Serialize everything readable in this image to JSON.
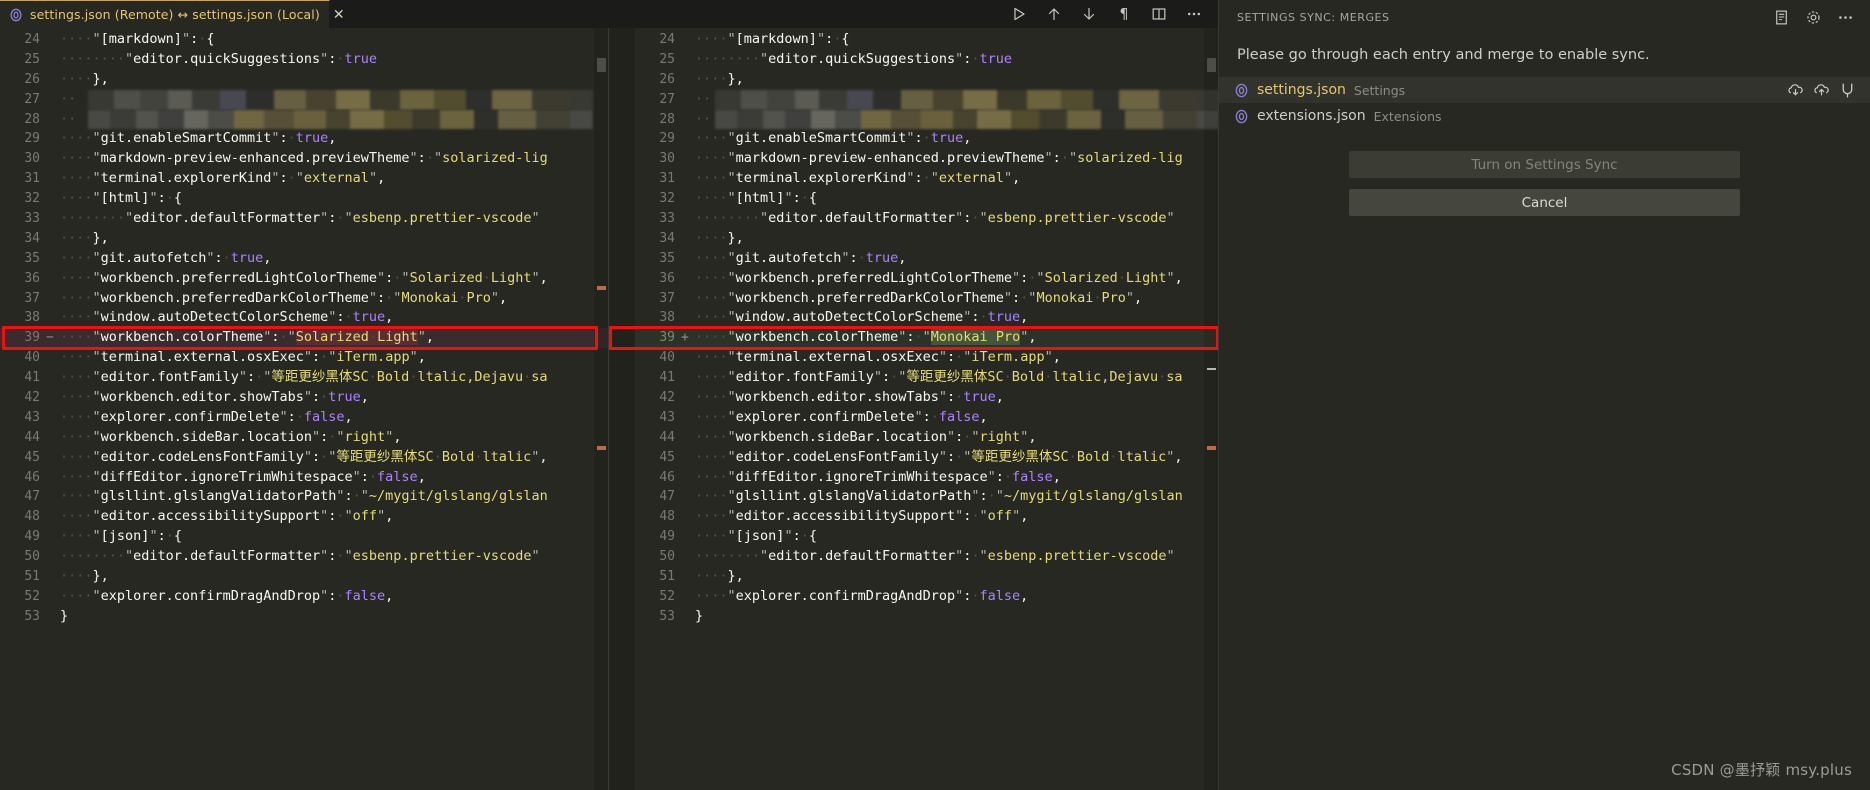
{
  "tab": {
    "icon": "json-file-icon",
    "label": "settings.json (Remote) ↔ settings.json (Local)",
    "close": "✕"
  },
  "toolbar": {
    "run_label": "▷",
    "prev_label": "↑",
    "next_label": "↓",
    "whitespace_label": "¶",
    "layout_label": "▥",
    "more_label": "⋯"
  },
  "diff": {
    "left_title": "settings.json (Remote)",
    "right_title": "settings.json (Local)",
    "left_lines": [
      {
        "n": "24",
        "sign": "",
        "state": "ctx",
        "indent": 4,
        "text": "\"[markdown]\": {"
      },
      {
        "n": "25",
        "sign": "",
        "state": "ctx",
        "indent": 8,
        "text": "\"editor.quickSuggestions\": true"
      },
      {
        "n": "26",
        "sign": "",
        "state": "ctx",
        "indent": 4,
        "text": "},"
      },
      {
        "n": "27",
        "sign": "",
        "state": "censored",
        "indent": 2,
        "text": ""
      },
      {
        "n": "28",
        "sign": "",
        "state": "censored",
        "indent": 2,
        "text": ""
      },
      {
        "n": "29",
        "sign": "",
        "state": "ctx",
        "indent": 4,
        "text": "\"git.enableSmartCommit\": true,"
      },
      {
        "n": "30",
        "sign": "",
        "state": "ctx",
        "indent": 4,
        "text": "\"markdown-preview-enhanced.previewTheme\": \"solarized-lig"
      },
      {
        "n": "31",
        "sign": "",
        "state": "ctx",
        "indent": 4,
        "text": "\"terminal.explorerKind\": \"external\","
      },
      {
        "n": "32",
        "sign": "",
        "state": "ctx",
        "indent": 4,
        "text": "\"[html]\": {"
      },
      {
        "n": "33",
        "sign": "",
        "state": "ctx",
        "indent": 8,
        "text": "\"editor.defaultFormatter\": \"esbenp.prettier-vscode\""
      },
      {
        "n": "34",
        "sign": "",
        "state": "ctx",
        "indent": 4,
        "text": "},"
      },
      {
        "n": "35",
        "sign": "",
        "state": "ctx",
        "indent": 4,
        "text": "\"git.autofetch\": true,"
      },
      {
        "n": "36",
        "sign": "",
        "state": "ctx",
        "indent": 4,
        "text": "\"workbench.preferredLightColorTheme\": \"Solarized Light\","
      },
      {
        "n": "37",
        "sign": "",
        "state": "ctx",
        "indent": 4,
        "text": "\"workbench.preferredDarkColorTheme\": \"Monokai Pro\","
      },
      {
        "n": "38",
        "sign": "",
        "state": "ctx",
        "indent": 4,
        "text": "\"window.autoDetectColorScheme\": true,"
      },
      {
        "n": "39",
        "sign": "−",
        "state": "deleted",
        "indent": 4,
        "text": "\"workbench.colorTheme\": \"Solarized Light\",",
        "highlight": "Solarized Light"
      },
      {
        "n": "40",
        "sign": "",
        "state": "ctx",
        "indent": 4,
        "text": "\"terminal.external.osxExec\": \"iTerm.app\","
      },
      {
        "n": "41",
        "sign": "",
        "state": "ctx",
        "indent": 4,
        "text": "\"editor.fontFamily\": \"等距更纱黑体SC Bold ltalic,Dejavu sa"
      },
      {
        "n": "42",
        "sign": "",
        "state": "ctx",
        "indent": 4,
        "text": "\"workbench.editor.showTabs\": true,"
      },
      {
        "n": "43",
        "sign": "",
        "state": "ctx",
        "indent": 4,
        "text": "\"explorer.confirmDelete\": false,"
      },
      {
        "n": "44",
        "sign": "",
        "state": "ctx",
        "indent": 4,
        "text": "\"workbench.sideBar.location\": \"right\","
      },
      {
        "n": "45",
        "sign": "",
        "state": "ctx",
        "indent": 4,
        "text": "\"editor.codeLensFontFamily\": \"等距更纱黑体SC Bold ltalic\","
      },
      {
        "n": "46",
        "sign": "",
        "state": "ctx",
        "indent": 4,
        "text": "\"diffEditor.ignoreTrimWhitespace\": false,"
      },
      {
        "n": "47",
        "sign": "",
        "state": "ctx",
        "indent": 4,
        "text": "\"glsllint.glslangValidatorPath\": \"~/mygit/glslang/glslan"
      },
      {
        "n": "48",
        "sign": "",
        "state": "ctx",
        "indent": 4,
        "text": "\"editor.accessibilitySupport\": \"off\","
      },
      {
        "n": "49",
        "sign": "",
        "state": "ctx",
        "indent": 4,
        "text": "\"[json]\": {"
      },
      {
        "n": "50",
        "sign": "",
        "state": "ctx",
        "indent": 8,
        "text": "\"editor.defaultFormatter\": \"esbenp.prettier-vscode\""
      },
      {
        "n": "51",
        "sign": "",
        "state": "ctx",
        "indent": 4,
        "text": "},"
      },
      {
        "n": "52",
        "sign": "",
        "state": "ctx",
        "indent": 4,
        "text": "\"explorer.confirmDragAndDrop\": false,"
      },
      {
        "n": "53",
        "sign": "",
        "state": "ctx",
        "indent": 0,
        "text": "}"
      }
    ],
    "right_lines": [
      {
        "n": "24",
        "sign": "",
        "state": "ctx",
        "indent": 4,
        "text": "\"[markdown]\": {"
      },
      {
        "n": "25",
        "sign": "",
        "state": "ctx",
        "indent": 8,
        "text": "\"editor.quickSuggestions\": true"
      },
      {
        "n": "26",
        "sign": "",
        "state": "ctx",
        "indent": 4,
        "text": "},"
      },
      {
        "n": "27",
        "sign": "",
        "state": "censored",
        "indent": 2,
        "text": ""
      },
      {
        "n": "28",
        "sign": "",
        "state": "censored",
        "indent": 2,
        "text": ""
      },
      {
        "n": "29",
        "sign": "",
        "state": "ctx",
        "indent": 4,
        "text": "\"git.enableSmartCommit\": true,"
      },
      {
        "n": "30",
        "sign": "",
        "state": "ctx",
        "indent": 4,
        "text": "\"markdown-preview-enhanced.previewTheme\": \"solarized-lig"
      },
      {
        "n": "31",
        "sign": "",
        "state": "ctx",
        "indent": 4,
        "text": "\"terminal.explorerKind\": \"external\","
      },
      {
        "n": "32",
        "sign": "",
        "state": "ctx",
        "indent": 4,
        "text": "\"[html]\": {"
      },
      {
        "n": "33",
        "sign": "",
        "state": "ctx",
        "indent": 8,
        "text": "\"editor.defaultFormatter\": \"esbenp.prettier-vscode\""
      },
      {
        "n": "34",
        "sign": "",
        "state": "ctx",
        "indent": 4,
        "text": "},"
      },
      {
        "n": "35",
        "sign": "",
        "state": "ctx",
        "indent": 4,
        "text": "\"git.autofetch\": true,"
      },
      {
        "n": "36",
        "sign": "",
        "state": "ctx",
        "indent": 4,
        "text": "\"workbench.preferredLightColorTheme\": \"Solarized Light\","
      },
      {
        "n": "37",
        "sign": "",
        "state": "ctx",
        "indent": 4,
        "text": "\"workbench.preferredDarkColorTheme\": \"Monokai Pro\","
      },
      {
        "n": "38",
        "sign": "",
        "state": "ctx",
        "indent": 4,
        "text": "\"window.autoDetectColorScheme\": true,"
      },
      {
        "n": "39",
        "sign": "+",
        "state": "inserted",
        "indent": 4,
        "text": "\"workbench.colorTheme\": \"Monokai Pro\",",
        "highlight": "Monokai Pro"
      },
      {
        "n": "40",
        "sign": "",
        "state": "ctx",
        "indent": 4,
        "text": "\"terminal.external.osxExec\": \"iTerm.app\","
      },
      {
        "n": "41",
        "sign": "",
        "state": "ctx",
        "indent": 4,
        "text": "\"editor.fontFamily\": \"等距更纱黑体SC Bold ltalic,Dejavu sa"
      },
      {
        "n": "42",
        "sign": "",
        "state": "ctx",
        "indent": 4,
        "text": "\"workbench.editor.showTabs\": true,"
      },
      {
        "n": "43",
        "sign": "",
        "state": "ctx",
        "indent": 4,
        "text": "\"explorer.confirmDelete\": false,"
      },
      {
        "n": "44",
        "sign": "",
        "state": "ctx",
        "indent": 4,
        "text": "\"workbench.sideBar.location\": \"right\","
      },
      {
        "n": "45",
        "sign": "",
        "state": "ctx",
        "indent": 4,
        "text": "\"editor.codeLensFontFamily\": \"等距更纱黑体SC Bold ltalic\","
      },
      {
        "n": "46",
        "sign": "",
        "state": "ctx",
        "indent": 4,
        "text": "\"diffEditor.ignoreTrimWhitespace\": false,"
      },
      {
        "n": "47",
        "sign": "",
        "state": "ctx",
        "indent": 4,
        "text": "\"glsllint.glslangValidatorPath\": \"~/mygit/glslang/glslan"
      },
      {
        "n": "48",
        "sign": "",
        "state": "ctx",
        "indent": 4,
        "text": "\"editor.accessibilitySupport\": \"off\","
      },
      {
        "n": "49",
        "sign": "",
        "state": "ctx",
        "indent": 4,
        "text": "\"[json]\": {"
      },
      {
        "n": "50",
        "sign": "",
        "state": "ctx",
        "indent": 8,
        "text": "\"editor.defaultFormatter\": \"esbenp.prettier-vscode\""
      },
      {
        "n": "51",
        "sign": "",
        "state": "ctx",
        "indent": 4,
        "text": "},"
      },
      {
        "n": "52",
        "sign": "",
        "state": "ctx",
        "indent": 4,
        "text": "\"explorer.confirmDragAndDrop\": false,"
      },
      {
        "n": "53",
        "sign": "",
        "state": "ctx",
        "indent": 0,
        "text": "}"
      }
    ]
  },
  "sidebar": {
    "title": "SETTINGS SYNC: MERGES",
    "header_icons": [
      "log-icon",
      "gear-icon",
      "more-icon"
    ],
    "message": "Please go through each entry and merge to enable sync.",
    "entries": [
      {
        "icon": "json-file-icon",
        "name": "settings.json",
        "desc": "Settings",
        "selected": true,
        "actions": [
          "accept-remote-icon",
          "accept-local-icon",
          "merge-icon"
        ]
      },
      {
        "icon": "json-file-icon",
        "name": "extensions.json",
        "desc": "Extensions",
        "selected": false,
        "actions": []
      }
    ],
    "buttons": [
      {
        "label": "Turn on Settings Sync",
        "kind": "primary"
      },
      {
        "label": "Cancel",
        "kind": "secondary"
      }
    ]
  },
  "annotation": {
    "color": "#f01010"
  },
  "watermark": "CSDN @墨抒颖 msy.plus",
  "colors": {
    "editor_bg": "#272822",
    "tab_accent": "#c8a45a",
    "string": "#e6db74",
    "bool": "#ae81ff",
    "key": "#f8f8f2",
    "deleted_bg": "#3a2b2e",
    "inserted_bg": "#2c3228"
  }
}
